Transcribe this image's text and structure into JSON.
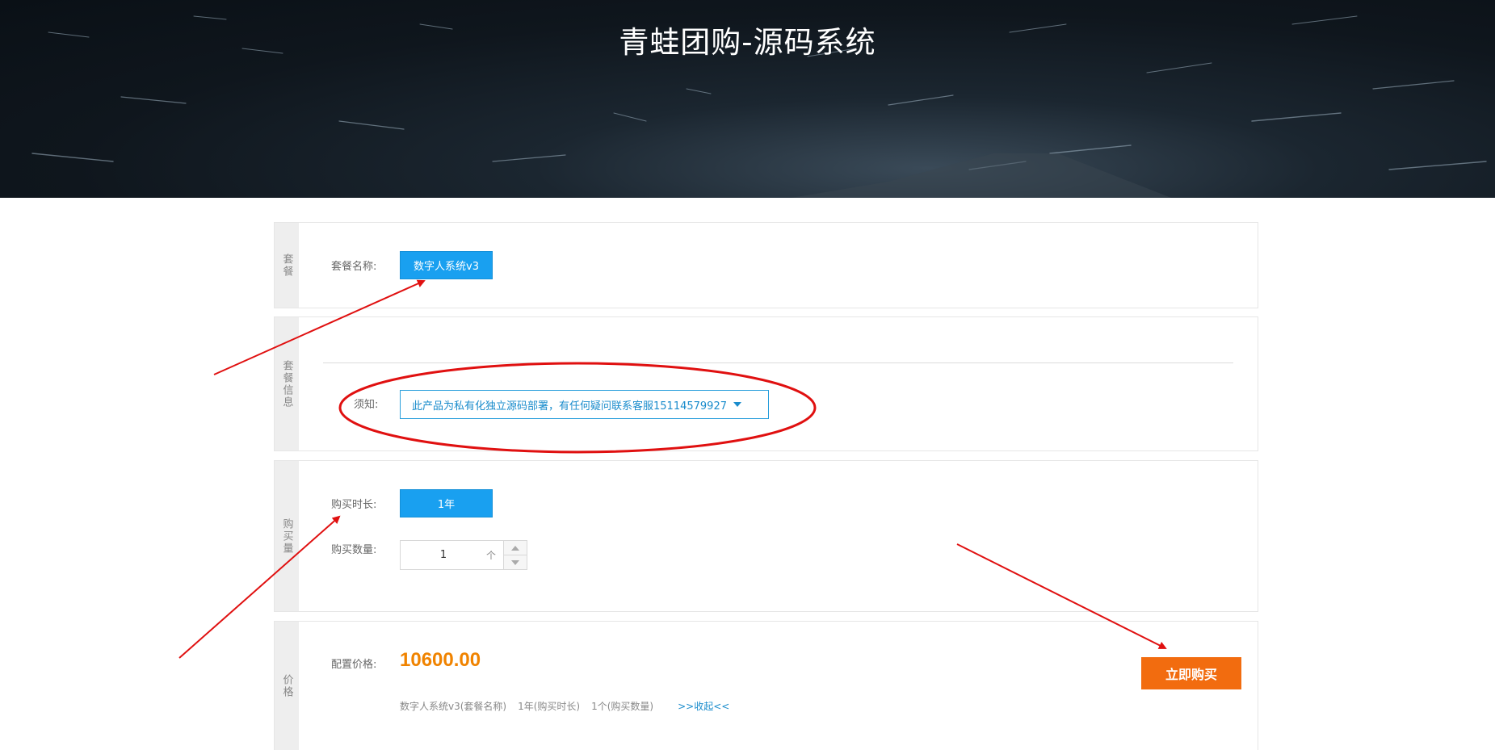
{
  "header": {
    "title": "青蛙团购-源码系统"
  },
  "package_section": {
    "side_label": "套餐",
    "name_label": "套餐名称:",
    "selected_package": "数字人系统v3"
  },
  "info_section": {
    "side_label": "套餐信息",
    "notice_label": "须知:",
    "notice_text": "此产品为私有化独立源码部署，有任何疑问联系客服15114579927"
  },
  "quantity_section": {
    "side_label": "购买量",
    "duration_label": "购买时长:",
    "duration_value": "1年",
    "quantity_label": "购买数量:",
    "quantity_value": "1",
    "quantity_unit": "个"
  },
  "price_section": {
    "side_label": "价格",
    "price_label": "配置价格:",
    "price_value": "10600.00",
    "summary_package": "数字人系统v3(套餐名称)",
    "summary_duration": "1年(购买时长)",
    "summary_quantity": "1个(购买数量)",
    "collapse_link": ">>收起<<",
    "buy_button": "立即购买"
  },
  "colors": {
    "accent_blue": "#19a0f0",
    "price_orange": "#f08300",
    "buy_orange": "#f26c0f",
    "annotation_red": "#e01010"
  }
}
